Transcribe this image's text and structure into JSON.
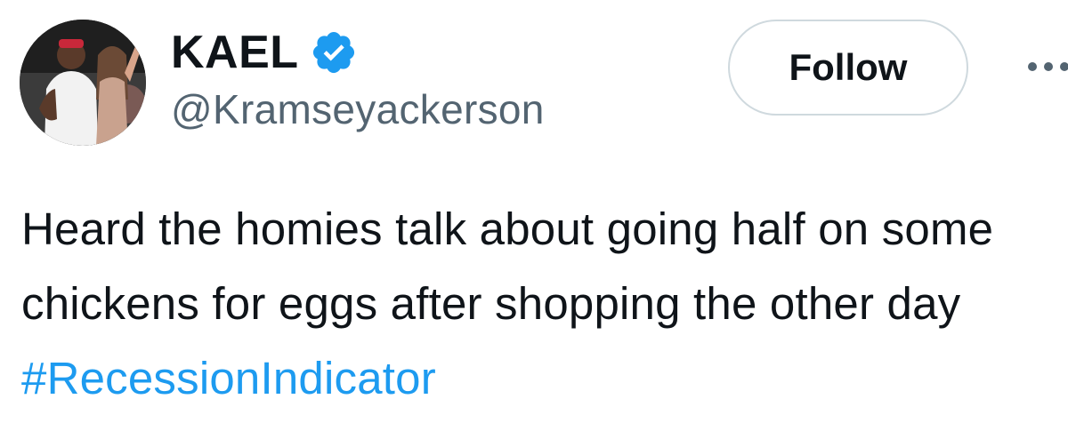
{
  "user": {
    "display_name": "KAEL",
    "handle": "@Kramseyackerson",
    "verified_icon": "verified-badge-icon",
    "verified_color": "#1d9bf0"
  },
  "actions": {
    "follow_label": "Follow",
    "more_icon": "more-horizontal-icon"
  },
  "tweet": {
    "text": "Heard the homies talk about going half on some chickens for eggs after shopping the other day",
    "hashtag": "#RecessionIndicator",
    "hashtag_color": "#1d9bf0"
  }
}
